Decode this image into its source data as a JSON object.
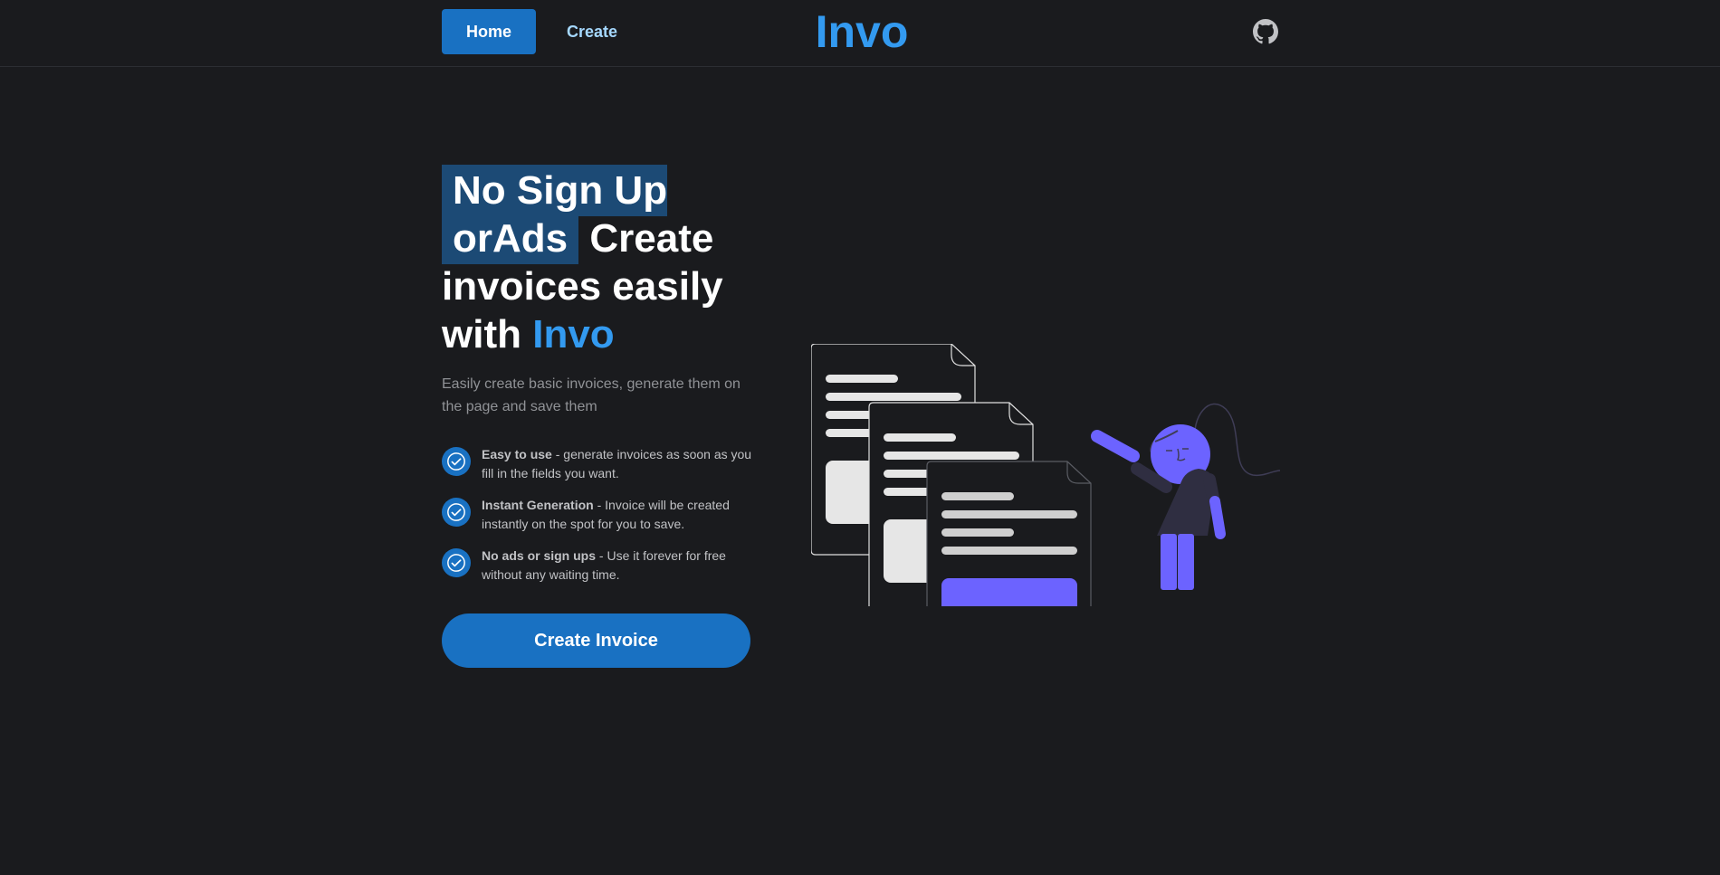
{
  "header": {
    "nav": {
      "home_label": "Home",
      "create_label": "Create"
    },
    "logo": "Invo",
    "github_icon": "github-icon"
  },
  "hero": {
    "title_highlight_1": "No Sign Up or",
    "title_highlight_2": "Ads",
    "title_line_rest": "Create invoices easily with",
    "title_brand": "Invo",
    "subtitle": "Easily create basic invoices, generate them on the page and save them",
    "features": [
      {
        "title": "Easy to use",
        "text": "generate invoices as soon as you fill in the fields you want.",
        "icon": "check-circle-icon"
      },
      {
        "title": "Instant Generation",
        "text": "Invoice will be created instantly on the spot for you to save.",
        "icon": "check-circle-icon"
      },
      {
        "title": "No ads or sign ups",
        "text": "Use it forever for free without any waiting time.",
        "icon": "check-circle-icon"
      }
    ],
    "cta_label": "Create Invoice"
  },
  "colors": {
    "background": "#1a1b1e",
    "primary": "#1971c2",
    "brand": "#339af0",
    "highlight": "#1c4a75",
    "illustration_accent": "#6c63ff"
  }
}
